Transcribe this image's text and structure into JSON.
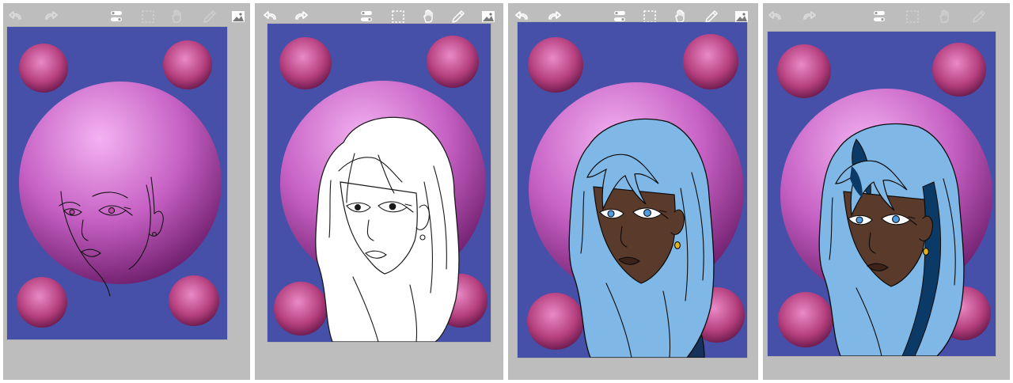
{
  "app": {
    "description_visible_text": ""
  },
  "colors": {
    "panel_bg": "#bdbdbd",
    "canvas_bg": "#4650a8",
    "big_orb_light": "#f0a8ee",
    "big_orb_dark": "#8a2a84",
    "small_orb_light": "#e77fc0",
    "small_orb_dark": "#7e1e5c",
    "hair_light": "#7fb8e6",
    "hair_dark": "#0c3a66",
    "skin": "#5a3a2a",
    "shirt": "#17325a",
    "icon": "#ffffff"
  },
  "toolbar": {
    "undo_icon": "undo-arrow-icon",
    "redo_icon": "redo-arrow-icon",
    "layer_toggle_icon": "layer-toggle-icon",
    "selection_icon": "marquee-selection-icon",
    "transform_icon": "hand-transform-icon",
    "pencil_icon": "pencil-icon",
    "image_icon": "image-gallery-icon"
  },
  "panels": [
    {
      "stage": "sketch",
      "toolbar_state": "dimmed"
    },
    {
      "stage": "lineart",
      "toolbar_state": "active"
    },
    {
      "stage": "base-colors",
      "toolbar_state": "active"
    },
    {
      "stage": "hair-shading",
      "toolbar_state": "dimmed"
    }
  ]
}
